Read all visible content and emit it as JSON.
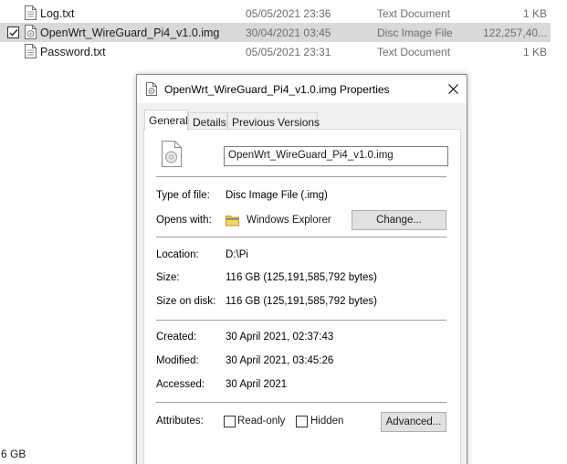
{
  "files": [
    {
      "name": "Log.txt",
      "date": "05/05/2021 23:36",
      "type": "Text Document",
      "size": "1 KB",
      "selected": false
    },
    {
      "name": "OpenWrt_WireGuard_Pi4_v1.0.img",
      "date": "30/04/2021 03:45",
      "type": "Disc Image File",
      "size": "122,257,40...",
      "selected": true
    },
    {
      "name": "Password.txt",
      "date": "05/05/2021 23:31",
      "type": "Text Document",
      "size": "1 KB",
      "selected": false
    }
  ],
  "status_bar": {
    "selected_size": "6 GB"
  },
  "dialog": {
    "title": "OpenWrt_WireGuard_Pi4_v1.0.img Properties",
    "close_icon": "close-icon",
    "tabs": [
      {
        "label": "General",
        "active": true
      },
      {
        "label": "Details",
        "active": false
      },
      {
        "label": "Previous Versions",
        "active": false
      }
    ],
    "filename": "OpenWrt_WireGuard_Pi4_v1.0.img",
    "type_label": "Type of file:",
    "type_value": "Disc Image File (.img)",
    "opens_label": "Opens with:",
    "opens_value": "Windows Explorer",
    "change_button": "Change...",
    "location_label": "Location:",
    "location_value": "D:\\Pi",
    "size_label": "Size:",
    "size_value": "116 GB (125,191,585,792 bytes)",
    "size_on_disk_label": "Size on disk:",
    "size_on_disk_value": "116 GB (125,191,585,792 bytes)",
    "created_label": "Created:",
    "created_value": "30 April 2021, 02:37:43",
    "modified_label": "Modified:",
    "modified_value": "30 April 2021, 03:45:26",
    "accessed_label": "Accessed:",
    "accessed_value": "30 April 2021",
    "attributes_label": "Attributes:",
    "readonly_label": "Read-only",
    "hidden_label": "Hidden",
    "advanced_button": "Advanced..."
  },
  "colors": {
    "selected_row": "#d9d9d9",
    "muted_text": "#6d6d6d",
    "folder_yellow": "#f4c542"
  }
}
